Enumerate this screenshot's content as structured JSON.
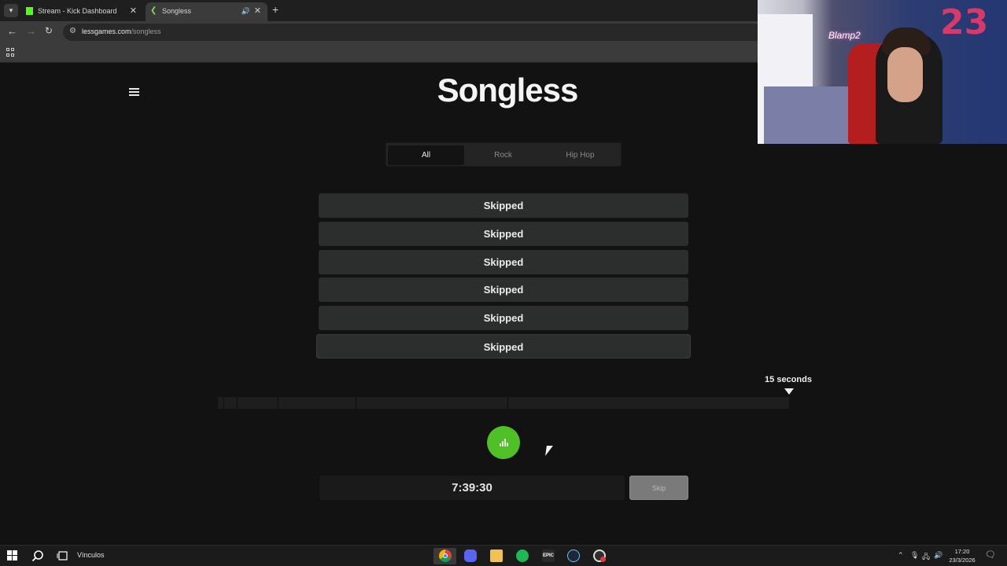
{
  "browser": {
    "tabs": [
      {
        "title": "Stream - Kick Dashboard",
        "favicon": "kick-icon",
        "active": false
      },
      {
        "title": "Songless",
        "favicon": "songless-icon",
        "active": true
      }
    ],
    "url": {
      "domain": "lessgames.com",
      "path": "/songless"
    }
  },
  "page": {
    "logo": "Songless",
    "genres": [
      "All",
      "Rock",
      "Hip Hop"
    ],
    "selected_genre": "All",
    "guesses": [
      "Skipped",
      "Skipped",
      "Skipped",
      "Skipped",
      "Skipped",
      "Skipped"
    ],
    "seconds_label": "15 seconds",
    "timer": "7:39:30",
    "skip_label": "Skip",
    "accent_color": "#4fc126"
  },
  "webcam": {
    "neon_sign": "Blamp2",
    "balloon_digits": "23"
  },
  "taskbar": {
    "search_text": "Vínculos",
    "apps": [
      "chrome-icon",
      "discord-icon",
      "file-explorer-icon",
      "spotify-icon",
      "epic-games-icon",
      "steam-icon",
      "obs-icon"
    ],
    "epic_label": "EPIC",
    "clock_time": "17:20",
    "clock_date": "23/3/2026"
  }
}
